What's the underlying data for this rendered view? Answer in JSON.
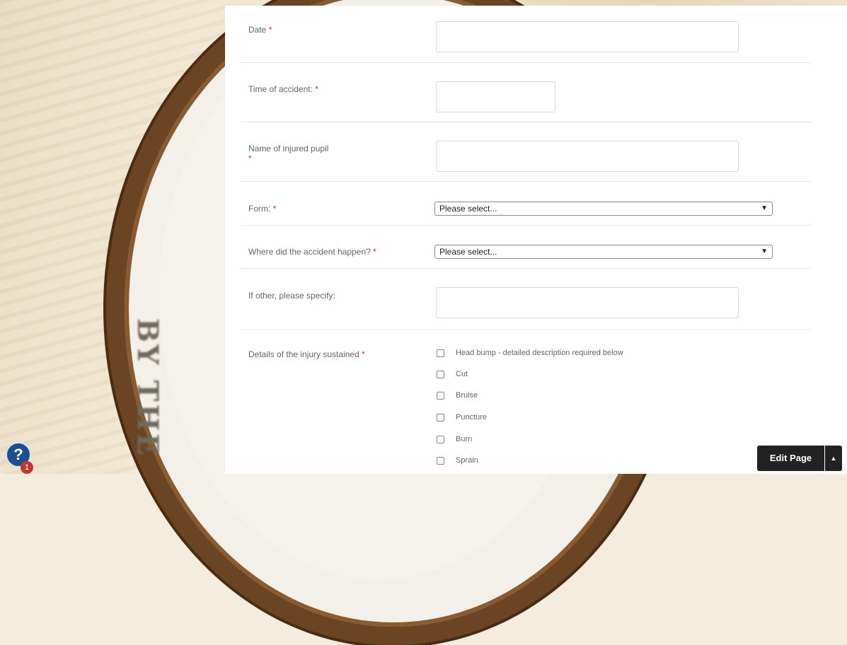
{
  "form": {
    "fields": [
      {
        "label": "Date",
        "required_mark": "*"
      },
      {
        "label": "Time of accident:",
        "required_mark": "*"
      },
      {
        "label": "Name of injured pupil",
        "required_mark": "*"
      },
      {
        "label": "Form:",
        "required_mark": "*",
        "selected": "Please select..."
      },
      {
        "label": "Where did the accident happen?",
        "required_mark": "*",
        "selected": "Please select..."
      },
      {
        "label": "If other, please specify:"
      },
      {
        "label": "Details of the injury sustained",
        "required_mark": "*"
      }
    ],
    "injury_options": [
      "Head bump - detailed description required below",
      "Cut",
      "Bruise",
      "Puncture",
      "Burn",
      "Sprain"
    ]
  },
  "background": {
    "clock_text": "BY THE"
  },
  "help": {
    "badge_count": "1",
    "glyph": "?"
  },
  "edit_page": {
    "label": "Edit Page"
  },
  "colors": {
    "required": "#c0392b",
    "help": "#1c4f8f",
    "edit_button": "#222222"
  }
}
